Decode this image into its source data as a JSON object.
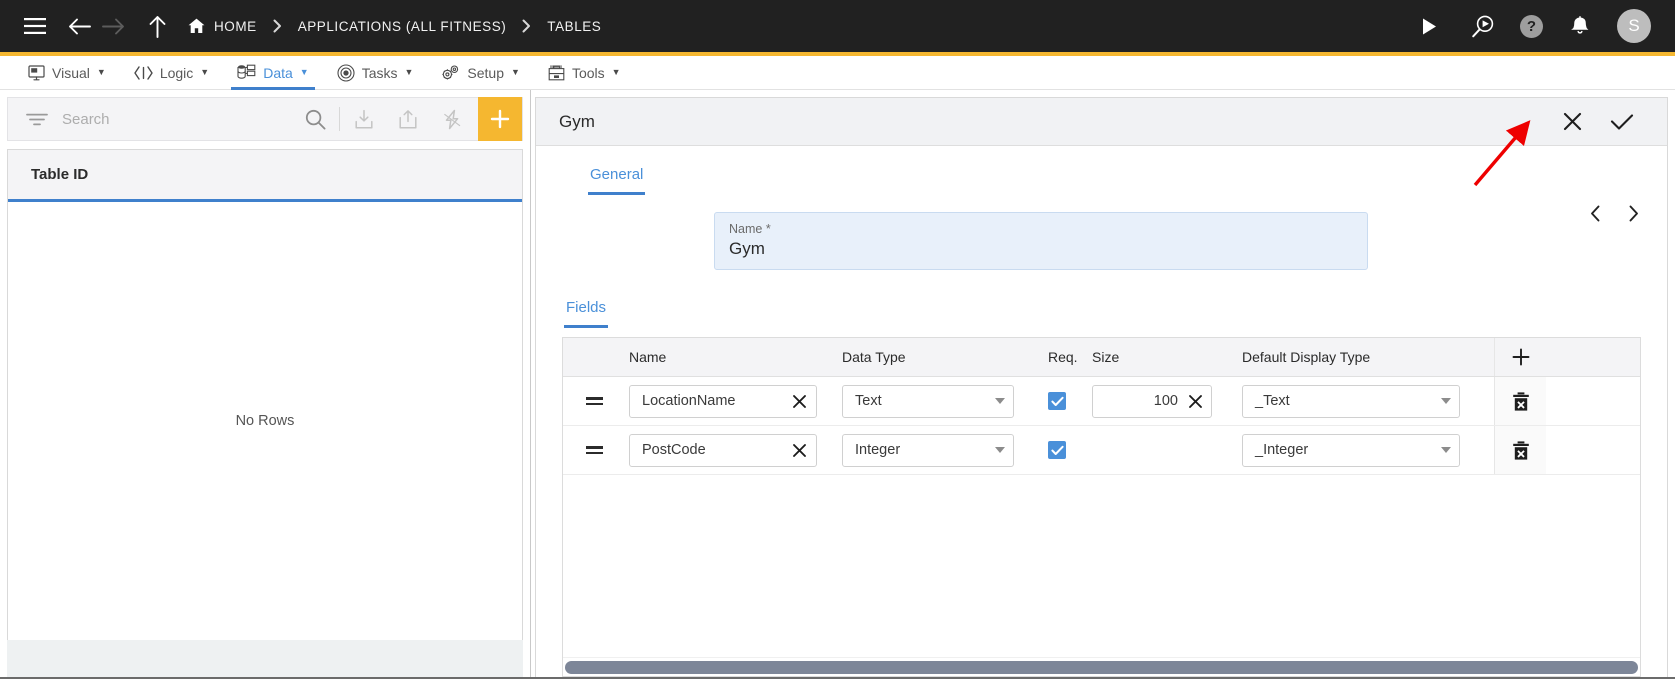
{
  "topbar": {
    "menu_icon": "hamburger-icon",
    "back_icon": "arrow-left-icon",
    "forward_icon": "arrow-right-icon",
    "up_icon": "arrow-up-icon",
    "breadcrumbs": [
      {
        "label": "HOME",
        "icon": "home-icon"
      },
      {
        "label": "APPLICATIONS (ALL FITNESS)",
        "icon": ""
      },
      {
        "label": "TABLES",
        "icon": ""
      }
    ],
    "actions": [
      {
        "name": "run-icon"
      },
      {
        "name": "search-run-icon"
      },
      {
        "name": "help-icon",
        "label": "?"
      },
      {
        "name": "notifications-bell-icon"
      }
    ],
    "avatar_initial": "S",
    "bg": "#212121"
  },
  "menubar": {
    "accent_color": "#f5b730",
    "active_color": "#4a90d9",
    "items": [
      {
        "label": "Visual",
        "icon": "monitor-icon",
        "active": false
      },
      {
        "label": "Logic",
        "icon": "code-icon",
        "active": false
      },
      {
        "label": "Data",
        "icon": "database-icon",
        "active": true
      },
      {
        "label": "Tasks",
        "icon": "target-icon",
        "active": false
      },
      {
        "label": "Setup",
        "icon": "gears-icon",
        "active": false
      },
      {
        "label": "Tools",
        "icon": "toolbox-icon",
        "active": false
      }
    ],
    "caret": "▼"
  },
  "left_panel": {
    "search": {
      "placeholder": "Search",
      "value": "",
      "filter_icon": "filter-icon",
      "search_icon": "search-icon"
    },
    "toolbar_buttons": [
      {
        "name": "import-icon"
      },
      {
        "name": "export-icon"
      },
      {
        "name": "lightning-icon"
      }
    ],
    "add_button": {
      "name": "add-button",
      "color": "#f5b730",
      "glyph": "+"
    },
    "grid": {
      "columns": [
        "Table ID"
      ],
      "rows": [],
      "empty_text": "No Rows",
      "header_underline_color": "#3f80cc"
    }
  },
  "right_panel": {
    "header": {
      "title": "Gym",
      "close_icon": "close-icon",
      "confirm_icon": "check-icon"
    },
    "pager": {
      "prev_icon": "chevron-left-icon",
      "next_icon": "chevron-right-icon"
    },
    "tabs": [
      {
        "label": "General",
        "active": true
      }
    ],
    "name_field": {
      "label": "Name *",
      "value": "Gym",
      "bg": "#e8f0fa"
    },
    "fields_section": {
      "tab_label": "Fields",
      "add_field_icon": "plus-icon",
      "columns": [
        "",
        "Name",
        "Data Type",
        "Req.",
        "Size",
        "Default Display Type",
        ""
      ],
      "column_headers": {
        "name": "Name",
        "data_type": "Data Type",
        "required": "Req.",
        "size": "Size",
        "default_display_type": "Default Display Type"
      },
      "rows": [
        {
          "drag_icon": "drag-handle-icon",
          "name": "LocationName",
          "name_clear_icon": "clear-icon",
          "data_type": "Text",
          "required": true,
          "size": "100",
          "size_clear_icon": "clear-icon",
          "default_display_type": "_Text",
          "delete_icon": "delete-icon"
        },
        {
          "drag_icon": "drag-handle-icon",
          "name": "PostCode",
          "name_clear_icon": "clear-icon",
          "data_type": "Integer",
          "required": true,
          "size": "",
          "size_clear_icon": "",
          "default_display_type": "_Integer",
          "delete_icon": "delete-icon"
        }
      ],
      "scrollbar": {
        "name": "horizontal-scrollbar",
        "color": "#7d8698"
      }
    }
  },
  "annotation": {
    "arrow_color": "#ee0000",
    "points_to": "confirm-check-button"
  }
}
